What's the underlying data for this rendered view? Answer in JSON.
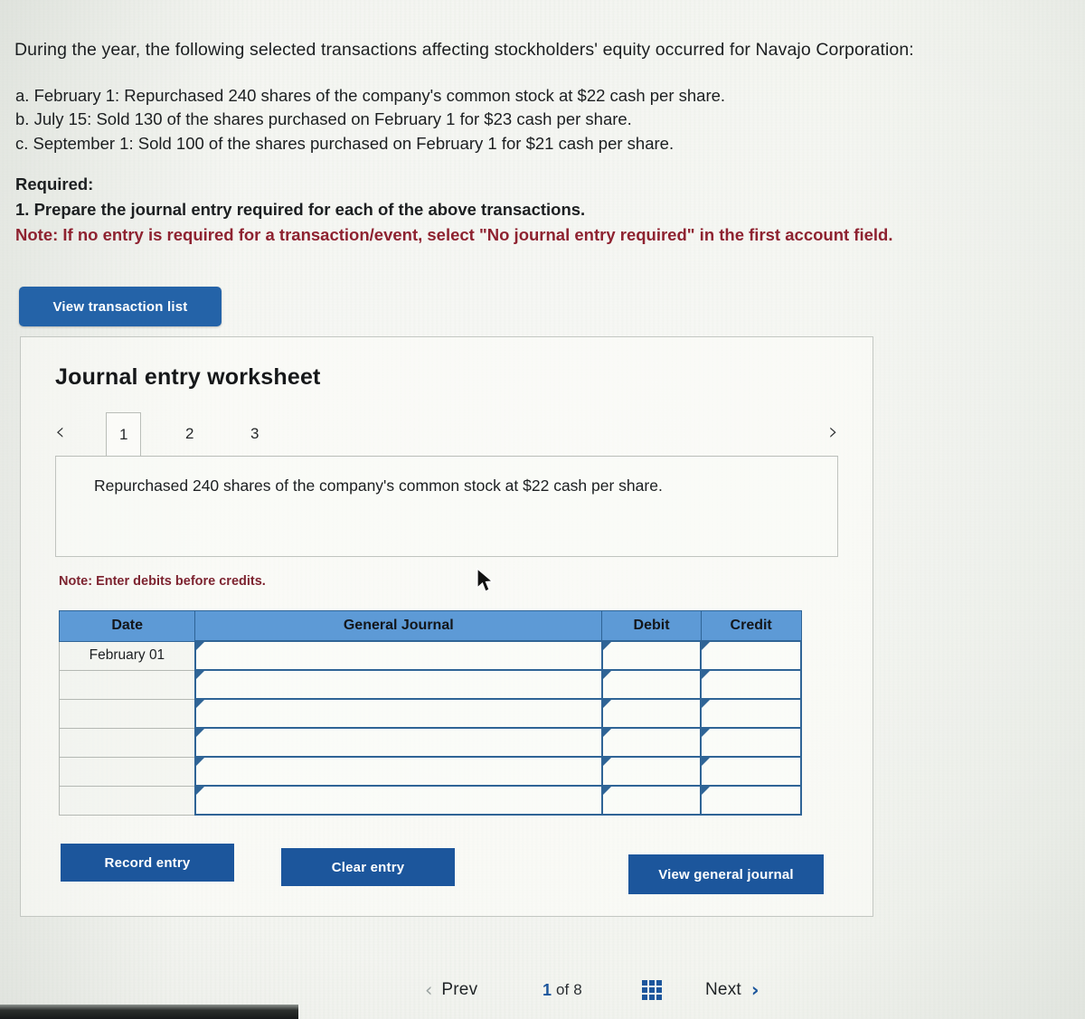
{
  "problem": {
    "intro": "During the year, the following selected transactions affecting stockholders' equity occurred for Navajo Corporation:",
    "transactions": [
      "a. February 1: Repurchased 240 shares of the company's common stock at $22 cash per share.",
      "b. July 15: Sold 130 of the shares purchased on February 1 for $23 cash per share.",
      "c. September 1: Sold 100 of the shares purchased on February 1 for $21 cash per share."
    ],
    "required_label": "Required:",
    "required_item": "1. Prepare the journal entry required for each of the above transactions.",
    "note": "Note: If no entry is required for a transaction/event, select \"No journal entry required\" in the first account field."
  },
  "actions": {
    "view_transaction_list": "View transaction list",
    "record_entry": "Record entry",
    "clear_entry": "Clear entry",
    "view_general_journal": "View general journal"
  },
  "worksheet": {
    "title": "Journal entry worksheet",
    "prev_arrow": "‹",
    "next_arrow": "›",
    "tabs": [
      {
        "label": "1",
        "active": true
      },
      {
        "label": "2",
        "active": false
      },
      {
        "label": "3",
        "active": false
      }
    ],
    "transaction_text": "Repurchased 240 shares of the company's common stock at $22 cash per share.",
    "enter_note": "Note: Enter debits before credits.",
    "table": {
      "headers": [
        "Date",
        "General Journal",
        "Debit",
        "Credit"
      ],
      "rows": [
        {
          "date": "February 01",
          "general_journal": "",
          "debit": "",
          "credit": ""
        },
        {
          "date": "",
          "general_journal": "",
          "debit": "",
          "credit": ""
        },
        {
          "date": "",
          "general_journal": "",
          "debit": "",
          "credit": ""
        },
        {
          "date": "",
          "general_journal": "",
          "debit": "",
          "credit": ""
        },
        {
          "date": "",
          "general_journal": "",
          "debit": "",
          "credit": ""
        },
        {
          "date": "",
          "general_journal": "",
          "debit": "",
          "credit": ""
        }
      ]
    }
  },
  "pager": {
    "prev_chevron": "‹",
    "prev_label": "Prev",
    "current": "1",
    "of": "of",
    "total": "8",
    "grid_icon": "grid-icon",
    "next_label": "Next",
    "next_chevron": "›"
  },
  "colors": {
    "primary_blue": "#1c569c",
    "button_blue": "#2463a8",
    "table_header_blue": "#5d9ad6",
    "table_border_blue": "#2f6496",
    "note_red": "#8e2230"
  }
}
